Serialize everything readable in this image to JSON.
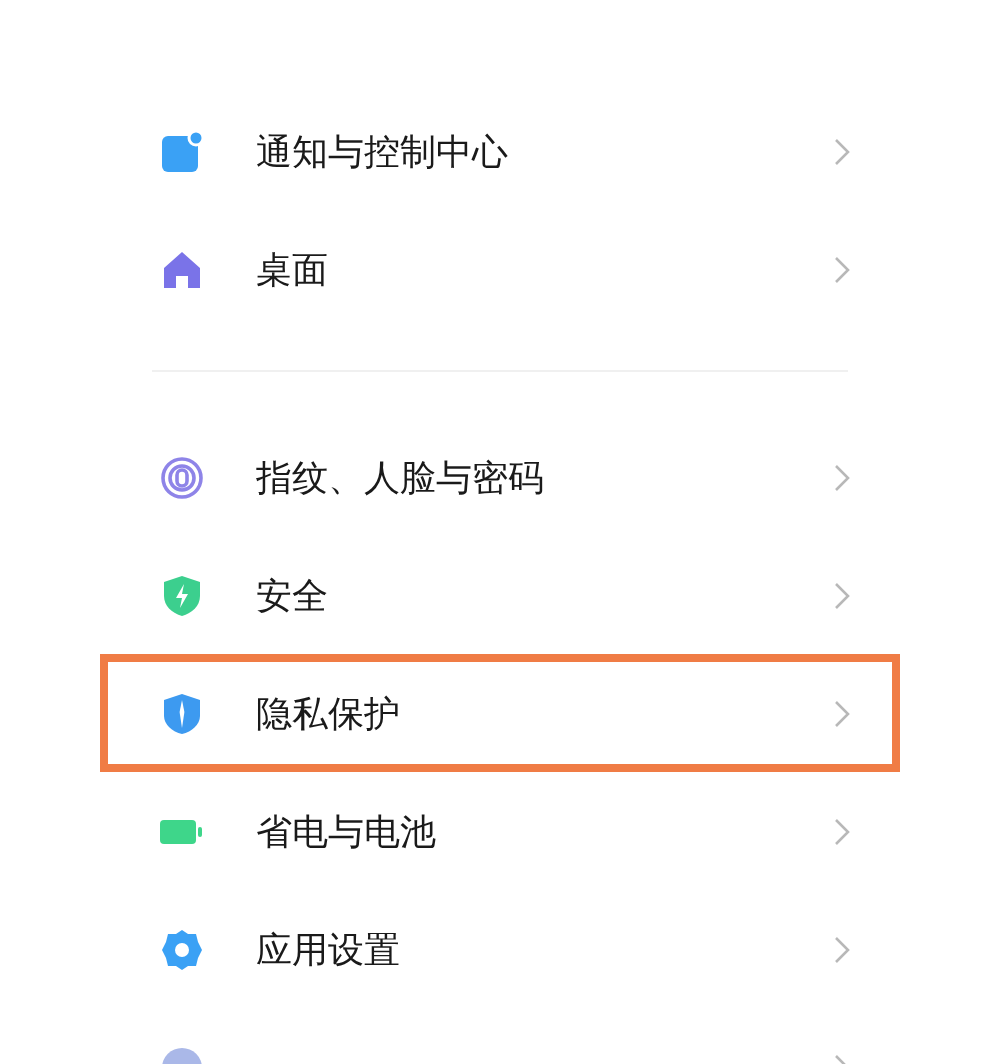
{
  "sections": [
    {
      "items": [
        {
          "label": "通知与控制中心",
          "kind": "notification",
          "highlighted": false
        },
        {
          "label": "桌面",
          "kind": "home",
          "highlighted": false
        }
      ]
    },
    {
      "items": [
        {
          "label": "指纹、人脸与密码",
          "kind": "fingerprint",
          "highlighted": false
        },
        {
          "label": "安全",
          "kind": "shield",
          "highlighted": false
        },
        {
          "label": "隐私保护",
          "kind": "privacy",
          "highlighted": true
        },
        {
          "label": "省电与电池",
          "kind": "battery",
          "highlighted": false
        },
        {
          "label": "应用设置",
          "kind": "gear",
          "highlighted": false
        },
        {
          "kind": "more",
          "highlighted": false
        }
      ]
    }
  ]
}
